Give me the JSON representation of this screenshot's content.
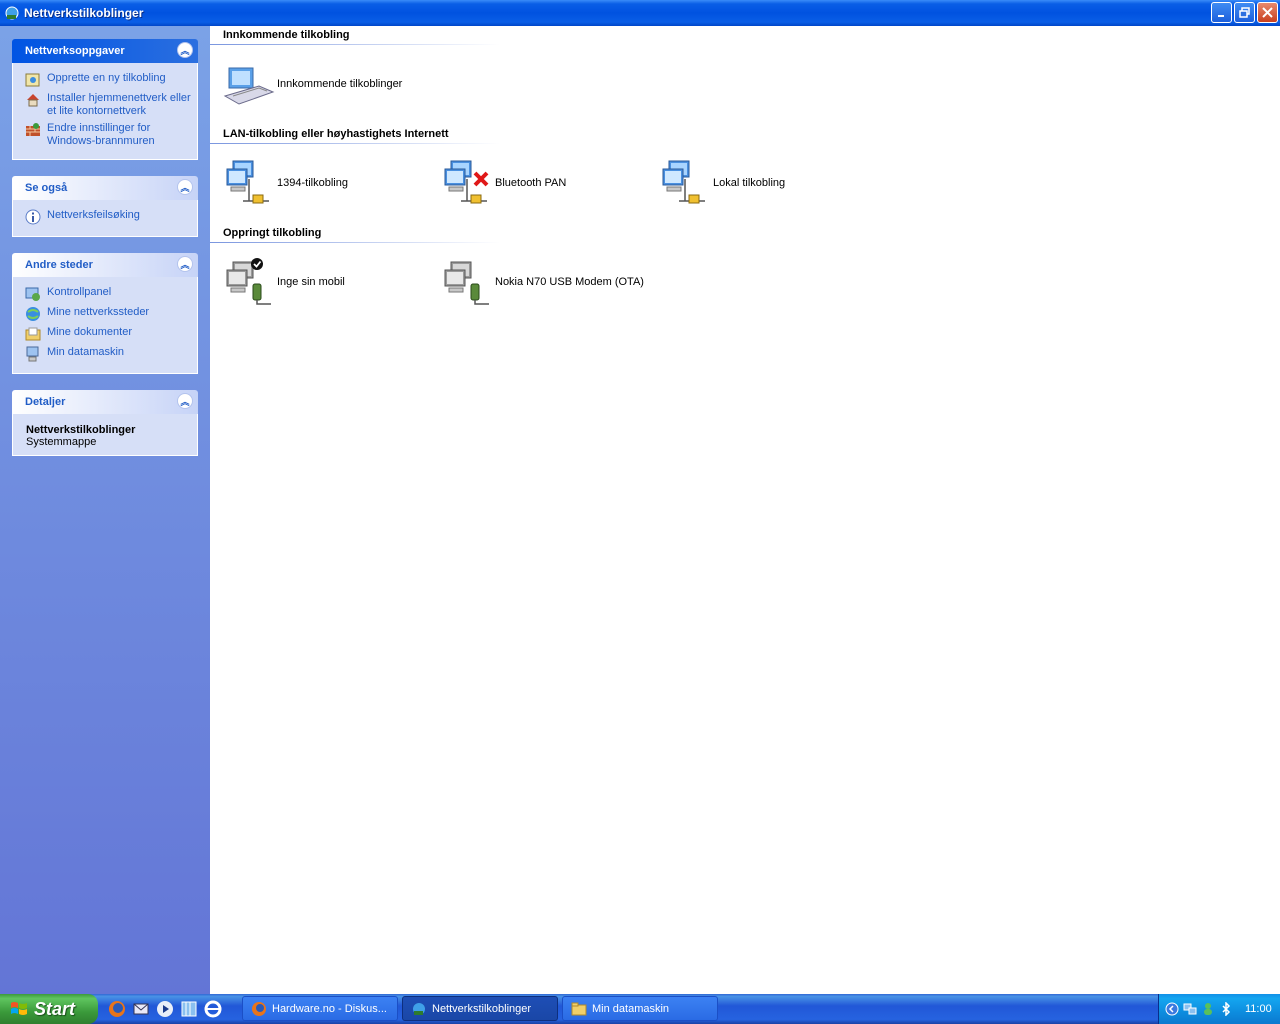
{
  "window": {
    "title": "Nettverkstilkoblinger"
  },
  "left_panels": {
    "network_tasks": {
      "header": "Nettverksoppgaver",
      "items": [
        {
          "label": "Opprette en ny tilkobling",
          "icon": "new-connection-icon"
        },
        {
          "label": "Installer hjemmenettverk eller et lite kontornettverk",
          "icon": "home-network-icon"
        },
        {
          "label": "Endre innstillinger for Windows-brannmuren",
          "icon": "firewall-icon"
        }
      ]
    },
    "see_also": {
      "header": "Se også",
      "items": [
        {
          "label": "Nettverksfeilsøking",
          "icon": "info-icon"
        }
      ]
    },
    "other_places": {
      "header": "Andre steder",
      "items": [
        {
          "label": "Kontrollpanel",
          "icon": "control-panel-icon"
        },
        {
          "label": "Mine nettverkssteder",
          "icon": "network-places-icon"
        },
        {
          "label": "Mine dokumenter",
          "icon": "documents-folder-icon"
        },
        {
          "label": "Min datamaskin",
          "icon": "computer-icon"
        }
      ]
    },
    "details": {
      "header": "Detaljer",
      "title": "Nettverkstilkoblinger",
      "subtitle": "Systemmappe"
    }
  },
  "groups": [
    {
      "title": "Innkommende tilkobling",
      "items": [
        {
          "label": "Innkommende tilkoblinger",
          "icon": "incoming-connection-icon"
        }
      ]
    },
    {
      "title": "LAN-tilkobling eller høyhastighets Internett",
      "items": [
        {
          "label": "1394-tilkobling",
          "icon": "lan-connection-icon"
        },
        {
          "label": "Bluetooth PAN",
          "icon": "lan-disconnected-icon"
        },
        {
          "label": "Lokal tilkobling",
          "icon": "lan-connection-icon"
        }
      ]
    },
    {
      "title": "Oppringt tilkobling",
      "items": [
        {
          "label": "Inge sin mobil",
          "icon": "dialup-default-icon"
        },
        {
          "label": "Nokia N70 USB Modem (OTA)",
          "icon": "dialup-icon"
        }
      ]
    }
  ],
  "taskbar": {
    "start_label": "Start",
    "buttons": [
      {
        "label": "Hardware.no - Diskus...",
        "icon": "firefox-icon"
      },
      {
        "label": "Nettverkstilkoblinger",
        "icon": "network-connections-icon"
      },
      {
        "label": "Min datamaskin",
        "icon": "folder-icon"
      }
    ],
    "clock": "11:00"
  }
}
